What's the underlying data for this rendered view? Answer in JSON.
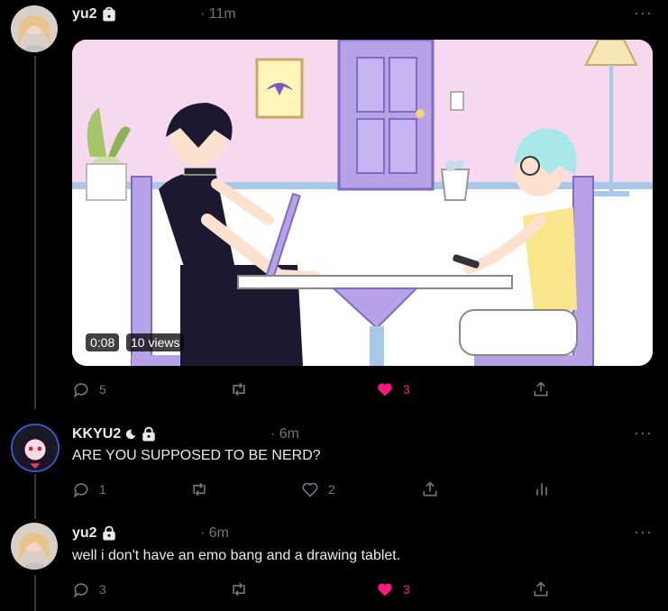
{
  "tweets": [
    {
      "author": "yu2",
      "time": "· 11m",
      "views": "10 views",
      "duration": "0:08",
      "replies": "5",
      "likes": "3"
    },
    {
      "author": "KKYU2",
      "time": "· 6m",
      "text": "ARE YOU SUPPOSED TO BE NERD?",
      "replies": "1",
      "likes": "2"
    },
    {
      "author": "yu2",
      "time": "· 6m",
      "text": "well i don't have an emo bang and a drawing tablet.",
      "replies": "3",
      "likes": "3"
    }
  ],
  "more_label": "···",
  "colors": {
    "background": "#000000",
    "like_active": "#f91880",
    "muted": "#71767b"
  }
}
